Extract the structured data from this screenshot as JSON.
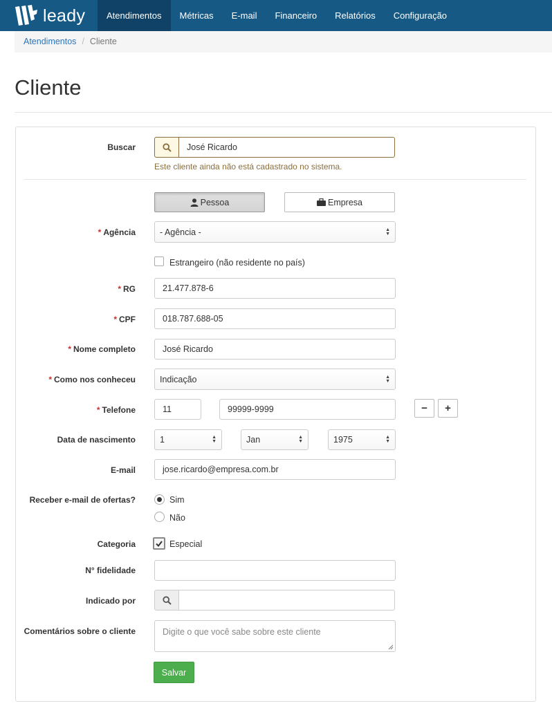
{
  "app": {
    "logo_text": "leady"
  },
  "nav": {
    "items": [
      {
        "label": "Atendimentos",
        "active": true
      },
      {
        "label": "Métricas"
      },
      {
        "label": "E-mail"
      },
      {
        "label": "Financeiro"
      },
      {
        "label": "Relatórios"
      },
      {
        "label": "Configuração"
      }
    ]
  },
  "breadcrumb": {
    "parent": "Atendimentos",
    "separator": "/",
    "current": "Cliente"
  },
  "page": {
    "title": "Cliente"
  },
  "form": {
    "search": {
      "label": "Buscar",
      "value": "José Ricardo",
      "help": "Este cliente ainda não está cadastrado no sistema."
    },
    "type_toggle": {
      "pessoa": "Pessoa",
      "empresa": "Empresa",
      "selected": "Pessoa"
    },
    "agencia": {
      "label": "Agência",
      "value": "- Agência -"
    },
    "estrangeiro": {
      "label": "Estrangeiro (não residente no país)",
      "checked": false
    },
    "rg": {
      "label": "RG",
      "value": "21.477.878-6"
    },
    "cpf": {
      "label": "CPF",
      "value": "018.787.688-05"
    },
    "nome": {
      "label": "Nome completo",
      "value": "José Ricardo"
    },
    "como_conheceu": {
      "label": "Como nos conheceu",
      "value": "Indicação"
    },
    "telefone": {
      "label": "Telefone",
      "ddd": "11",
      "number": "99999-9999",
      "minus": "−",
      "plus": "+"
    },
    "nascimento": {
      "label": "Data de nascimento",
      "day": "1",
      "month": "Jan",
      "year": "1975"
    },
    "email": {
      "label": "E-mail",
      "value": "jose.ricardo@empresa.com.br"
    },
    "ofertas": {
      "label": "Receber e-mail de ofertas?",
      "sim": "Sim",
      "nao": "Não",
      "selected": "Sim"
    },
    "categoria": {
      "label": "Categoria",
      "option": "Especial",
      "checked": true
    },
    "fidelidade": {
      "label": "N° fidelidade",
      "value": ""
    },
    "indicado": {
      "label": "Indicado por",
      "value": ""
    },
    "comentarios": {
      "label": "Comentários sobre o cliente",
      "placeholder": "Digite o que você sabe sobre este cliente"
    },
    "save_label": "Salvar"
  },
  "colors": {
    "nav_bg": "#175985",
    "nav_active": "#0f4266",
    "warning": "#8a6d3b",
    "required": "#c9302c",
    "success": "#4cae4c"
  }
}
